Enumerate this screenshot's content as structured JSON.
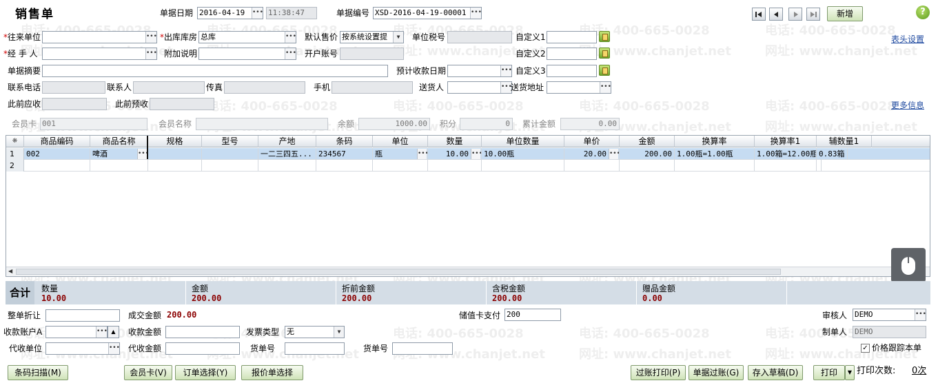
{
  "title": "销售单",
  "header": {
    "date_label": "单据日期",
    "date_value": "2016-04-19",
    "time_value": "11:38:47",
    "code_label": "单据编号",
    "code_value": "XSD-2016-04-19-00001",
    "new_button": "新增"
  },
  "form": {
    "partner_label": "往来单位",
    "warehouse_label": "出库库房",
    "warehouse_value": "总库",
    "price_label": "默认售价",
    "price_value": "按系统设置提",
    "tax_label": "单位税号",
    "custom1_label": "自定义1",
    "handler_label": "经 手 人",
    "extra_label": "附加说明",
    "account_label": "开户账号",
    "custom2_label": "自定义2",
    "summary_label": "单据摘要",
    "due_label": "预计收款日期",
    "custom3_label": "自定义3",
    "phone_label": "联系电话",
    "contact_label": "联系人",
    "fax_label": "传真",
    "mobile_label": "手机",
    "deliver_label": "送货人",
    "address_label": "送货地址",
    "prev_recv_label": "此前应收",
    "prev_pre_label": "此前预收",
    "member_label": "会员卡",
    "member_value": "001",
    "member_name_label": "会员名称",
    "balance_label": "余额",
    "balance_value": "1000.00",
    "points_label": "积分",
    "points_value": "0",
    "accum_label": "累计金额",
    "accum_value": "0.00",
    "header_settings_link": "表头设置",
    "more_info_link": "更多信息"
  },
  "grid": {
    "columns": [
      "商品编码",
      "商品名称",
      "规格",
      "型号",
      "产地",
      "条码",
      "单位",
      "数量",
      "单位数量",
      "单价",
      "金额",
      "换算率",
      "换算率1",
      "辅数量1"
    ],
    "rows": [
      {
        "num": "1",
        "code": "002",
        "name": "啤酒",
        "spec": "",
        "model": "",
        "origin": "一二三四五...",
        "barcode": "234567",
        "unit": "瓶",
        "qty": "10.00",
        "unit_qty": "10.00瓶",
        "price": "20.00",
        "amount": "200.00",
        "rate": "1.00瓶=1.00瓶",
        "rate1": "1.00箱=12.00瓶",
        "aux_qty1": "0.83箱"
      },
      {
        "num": "2",
        "code": "",
        "name": "",
        "spec": "",
        "model": "",
        "origin": "",
        "barcode": "",
        "unit": "",
        "qty": "",
        "unit_qty": "",
        "price": "",
        "amount": "",
        "rate": "",
        "rate1": "",
        "aux_qty1": ""
      }
    ]
  },
  "summary": {
    "total_label": "合计",
    "qty_label": "数量",
    "qty_value": "10.00",
    "amount_label": "金额",
    "amount_value": "200.00",
    "pre_discount_label": "折前金额",
    "pre_discount_value": "200.00",
    "tax_amount_label": "含税金额",
    "tax_amount_value": "200.00",
    "gift_label": "赠品金额",
    "gift_value": "0.00"
  },
  "footer": {
    "discount_label": "整单折让",
    "deal_label": "成交金额",
    "deal_value": "200.00",
    "stored_card_label": "储值卡支付",
    "stored_card_value": "200",
    "auditor_label": "审核人",
    "auditor_value": "DEMO",
    "recv_account_label": "收款账户A",
    "recv_amount_label": "收款金额",
    "invoice_label": "发票类型",
    "invoice_value": "无",
    "maker_label": "制单人",
    "maker_value": "DEMO",
    "agent_unit_label": "代收单位",
    "agent_amount_label": "代收金额",
    "waybill_label": "货单号",
    "price_track_label": "价格跟踪本单"
  },
  "buttons": {
    "barcode_scan": "条码扫描(M)",
    "member_card": "会员卡(V)",
    "order_select": "订单选择(Y)",
    "quote_select": "报价单选择",
    "post_print": "过账打印(P)",
    "post": "单据过账(G)",
    "save_draft": "存入草稿(D)",
    "print": "打印",
    "print_count_label": "打印次数:",
    "print_count_value": "0次"
  },
  "watermark": {
    "phone": "电话: 400-665-0028",
    "site": "网址: www.chanjet.net"
  }
}
